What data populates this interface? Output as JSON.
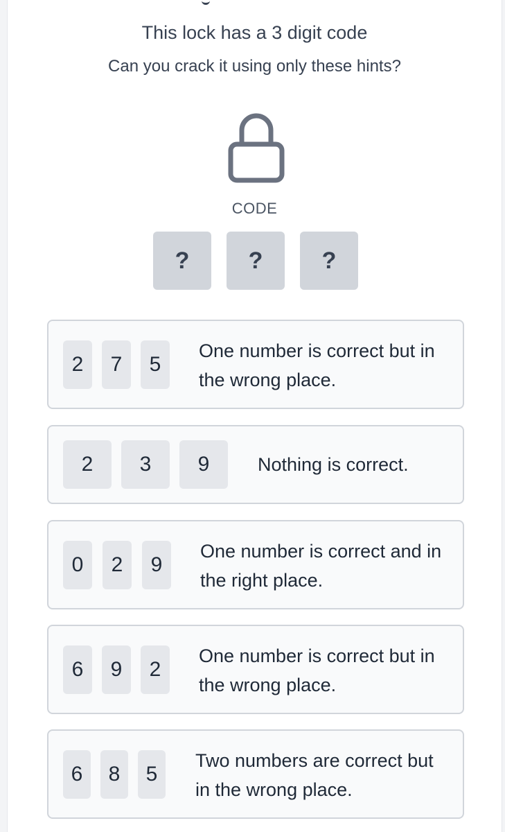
{
  "header": {
    "title": "This lock has a 3 digit code",
    "subtitle": "Can you crack it using only these hints?"
  },
  "lock": {
    "icon": "padlock-icon",
    "code_label": "CODE"
  },
  "code_slots": [
    "?",
    "?",
    "?"
  ],
  "hints": [
    {
      "digits": [
        "2",
        "7",
        "5"
      ],
      "text": "One number is correct but in the wrong place."
    },
    {
      "digits": [
        "2",
        "3",
        "9"
      ],
      "text": "Nothing is correct."
    },
    {
      "digits": [
        "0",
        "2",
        "9"
      ],
      "text": "One number is correct and in the right place."
    },
    {
      "digits": [
        "6",
        "9",
        "2"
      ],
      "text": "One number is correct but in the wrong place."
    },
    {
      "digits": [
        "6",
        "8",
        "5"
      ],
      "text": "Two numbers are correct but in the wrong place."
    }
  ]
}
